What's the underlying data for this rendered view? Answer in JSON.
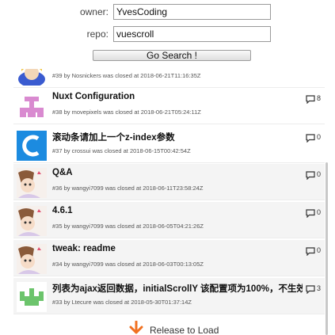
{
  "form": {
    "owner_label": "owner:",
    "owner_value": "YvesCoding",
    "repo_label": "repo:",
    "repo_value": "vuescroll",
    "search_button": "Go Search !"
  },
  "issues": [
    {
      "title": "",
      "meta": "#39 by Nosnickers was closed at 2018-06-21T11:16:35Z",
      "comments": ""
    },
    {
      "title": "Nuxt Configuration",
      "meta": "#38 by movepixels was closed at 2018-06-21T05:24:11Z",
      "comments": "8"
    },
    {
      "title": "滚动条请加上一个z-index参数",
      "meta": "#37 by crossui was closed at 2018-06-15T00:42:54Z",
      "comments": "0"
    },
    {
      "title": "Q&A",
      "meta": "#36 by wangyi7099 was closed at 2018-06-11T23:58:24Z",
      "comments": "0"
    },
    {
      "title": "4.6.1",
      "meta": "#35 by wangyi7099 was closed at 2018-06-05T04:21:26Z",
      "comments": "0"
    },
    {
      "title": "tweak: readme",
      "meta": "#34 by wangyi7099 was closed at 2018-06-03T00:13:05Z",
      "comments": "0"
    },
    {
      "title": "列表为ajax返回数据，initialScrollY 该配置项为100%，不生效",
      "meta": "#33 by Ltecure was closed at 2018-05-30T01:37:14Z",
      "comments": "3"
    }
  ],
  "pull_refresh": {
    "label": "Release to Load",
    "icon": "arrow-down-icon",
    "color": "#f07020"
  },
  "colors": {
    "pink_avatar": "#d98ad0",
    "green_avatar": "#6cc46c",
    "blue_avatar": "#1c8be0"
  }
}
